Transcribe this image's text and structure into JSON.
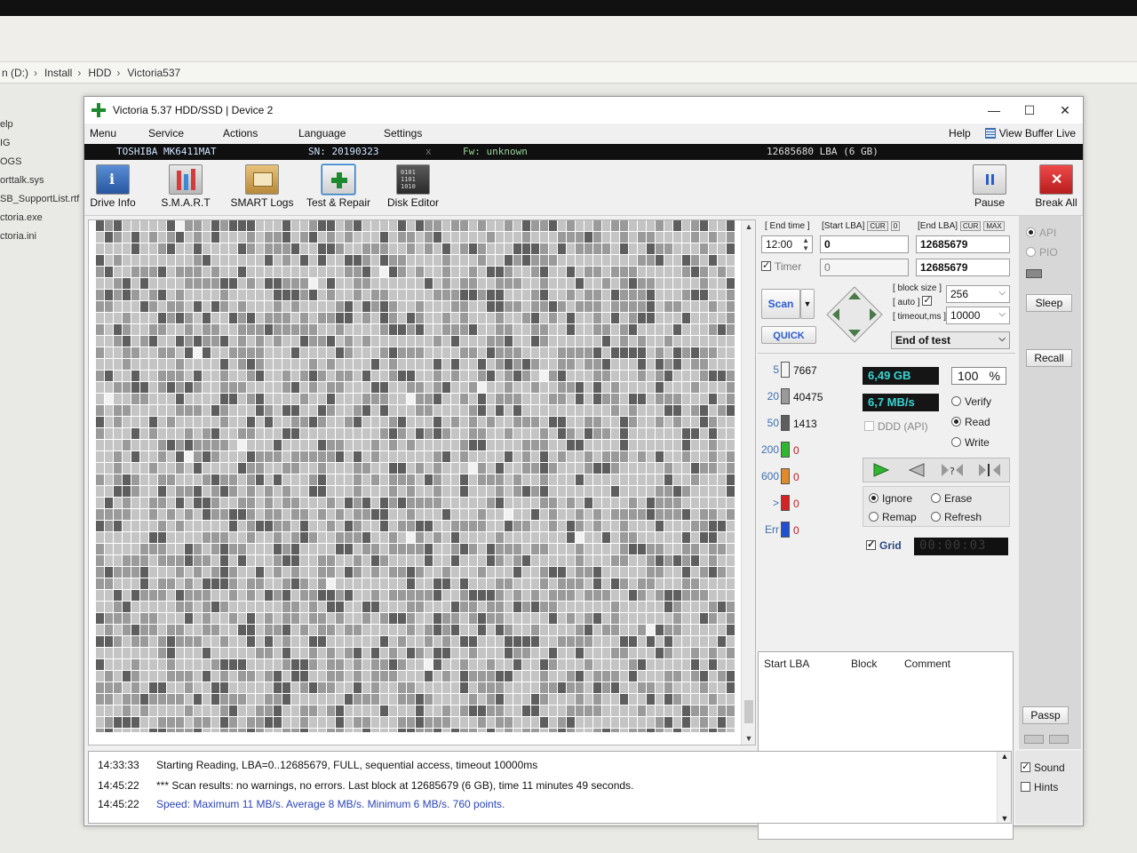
{
  "explorer": {
    "breadcrumb": [
      "n (D:)",
      "Install",
      "HDD",
      "Victoria537"
    ],
    "files": [
      "elp",
      "IG",
      "OGS",
      "orttalk.sys",
      "SB_SupportList.rtf",
      "ctoria.exe",
      "ctoria.ini"
    ]
  },
  "window": {
    "title": "Victoria 5.37 HDD/SSD | Device 2",
    "minimize": "—",
    "maximize": "☐",
    "close": "✕"
  },
  "menu": {
    "items": [
      "Menu",
      "Service",
      "Actions",
      "Language",
      "Settings"
    ],
    "help": "Help",
    "view_buffer": "View Buffer Live"
  },
  "device": {
    "model": "TOSHIBA MK6411MAT",
    "serial": "SN: 20190323",
    "x": "x",
    "firmware": "Fw: unknown",
    "capacity": "12685680 LBA (6 GB)"
  },
  "toolbar": {
    "drive_info": "Drive Info",
    "smart": "S.M.A.R.T",
    "smart_logs": "SMART Logs",
    "test_repair": "Test & Repair",
    "disk_editor": "Disk Editor",
    "pause": "Pause",
    "break_all": "Break All"
  },
  "controls": {
    "end_time_label": "[ End time ]",
    "end_time_value": "12:00",
    "timer_label": "Timer",
    "start_lba_label": "[Start LBA]",
    "start_lba_cur": "CUR",
    "start_lba_zero": "0",
    "start_lba_value": "0",
    "start_lba_current": "0",
    "end_lba_label": "[End LBA]",
    "end_lba_cur": "CUR",
    "end_lba_max": "MAX",
    "end_lba_value": "12685679",
    "end_lba_current": "12685679",
    "block_size_label": "[ block size ]",
    "auto_label": "[ auto ]",
    "block_size_value": "256",
    "timeout_label": "[ timeout,ms ]",
    "timeout_value": "10000",
    "scan_button": "Scan",
    "quick_button": "QUICK",
    "end_action": "End of test"
  },
  "legend": [
    {
      "ms": "5",
      "count": "7667",
      "color": "#f4f4f4"
    },
    {
      "ms": "20",
      "count": "40475",
      "color": "#9a9a9a"
    },
    {
      "ms": "50",
      "count": "1413",
      "color": "#5e5e5e"
    },
    {
      "ms": "200",
      "count": "0",
      "color": "#2fb52f"
    },
    {
      "ms": "600",
      "count": "0",
      "color": "#e08a2a"
    },
    {
      "ms": ">",
      "count": "0",
      "color": "#d42323"
    },
    {
      "ms": "Err",
      "count": "0",
      "color": "#2050d0"
    }
  ],
  "stats": {
    "size": "6,49 GB",
    "percent": "100",
    "percent_sign": "%",
    "speed": "6,7 MB/s",
    "ddd": "DDD (API)",
    "mode_verify": "Verify",
    "mode_read": "Read",
    "mode_write": "Write",
    "act_ignore": "Ignore",
    "act_erase": "Erase",
    "act_remap": "Remap",
    "act_refresh": "Refresh",
    "grid_label": "Grid",
    "timer": "00:00:03"
  },
  "table": {
    "col_start": "Start LBA",
    "col_block": "Block",
    "col_comment": "Comment"
  },
  "side": {
    "api": "API",
    "pio": "PIO",
    "sleep": "Sleep",
    "recall": "Recall",
    "passp": "Passp",
    "sound": "Sound",
    "hints": "Hints"
  },
  "log": [
    {
      "time": "14:33:33",
      "msg": "Starting Reading, LBA=0..12685679, FULL, sequential access, timeout 10000ms"
    },
    {
      "time": "14:45:22",
      "msg": "*** Scan results: no warnings, no errors. Last block at 12685679 (6 GB), time 11 minutes 49 seconds."
    },
    {
      "time": "14:45:22",
      "msg": "Speed: Maximum 11 MB/s. Average 8 MB/s. Minimum 6 MB/s. 760 points."
    }
  ],
  "colors": {
    "map_cell_light": "#c4c4c4",
    "map_cell_mid": "#9a9a9a",
    "map_cell_dark": "#5e5e5e",
    "lcd_text": "#38d4d4",
    "log_blue": "#2a45b8"
  }
}
